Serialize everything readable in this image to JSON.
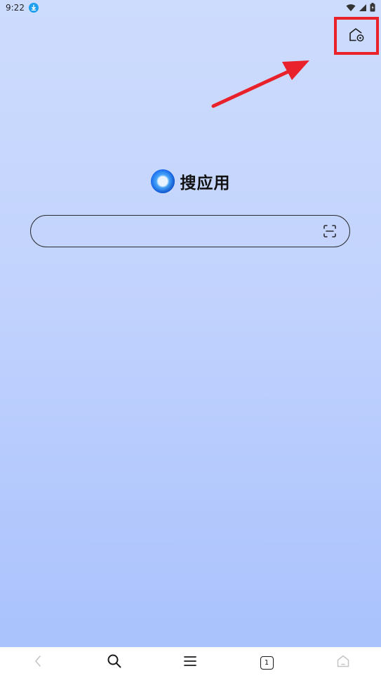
{
  "status_bar": {
    "time": "9:22",
    "icons": [
      "download-icon",
      "wifi-icon",
      "cellular-icon",
      "battery-icon"
    ]
  },
  "brand": {
    "name": "搜应用",
    "logo_icon": "app-logo-icon"
  },
  "search": {
    "value": "",
    "placeholder": "",
    "right_icon": "scan-icon"
  },
  "top_right": {
    "icon": "home-settings-icon",
    "highlight_color": "#e8212b"
  },
  "bottom_nav": {
    "items": [
      {
        "icon": "back-icon"
      },
      {
        "icon": "search-icon"
      },
      {
        "icon": "menu-icon"
      },
      {
        "icon": "tabs-icon",
        "count": "1"
      },
      {
        "icon": "home-icon"
      }
    ]
  },
  "colors": {
    "background_top": "#cddcfd",
    "background_bottom": "#abc3fd",
    "annotation_red": "#e8212b"
  }
}
